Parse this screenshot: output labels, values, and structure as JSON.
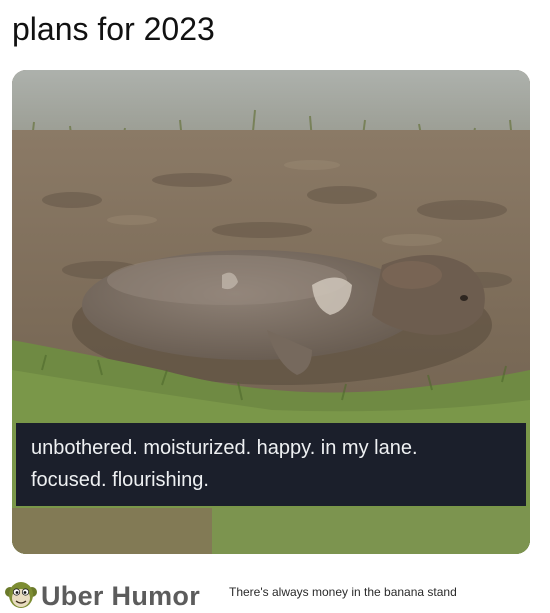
{
  "title": "plans for 2023",
  "image": {
    "subject": "capybara-in-mud",
    "caption": {
      "line1": "unbothered. moisturized. happy. in my lane.",
      "line2": "focused. flourishing."
    }
  },
  "footer": {
    "brand": "Uber Humor",
    "tagline": "There's always money in the banana stand",
    "logo_icon": "monkey-face-icon"
  },
  "colors": {
    "caption_background": "#1b1f2b",
    "caption_text": "#eef0f2",
    "brand_text": "#5c5c5c",
    "mud": "#7d6d5a",
    "grass": "#6f8a43",
    "water": "#a6aaa4"
  }
}
